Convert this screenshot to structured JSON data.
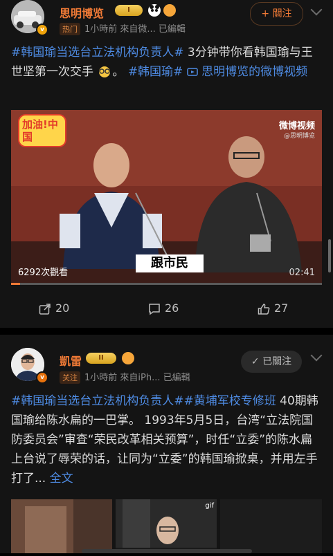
{
  "post1": {
    "author": "思明博览",
    "level": "I",
    "tag": "热门",
    "meta": "1小時前  來自微...  已編輯",
    "follow_label": "+ 關注",
    "text_hashtag1": "#韩国瑜当选台立法机构负责人#",
    "text_body": " 3分钟带你看韩国瑜与王世坚第一次交手",
    "text_end": "。",
    "text_hashtag2": "#韩国瑜#",
    "text_video_link": "思明博览的微博视频",
    "video": {
      "banner": "加油!中国",
      "watermark": "微博视频",
      "watermark_sub": "@思明博览",
      "view_count": "6292次觀看",
      "subtitle": "跟市民",
      "duration": "02:41",
      "progress": 0.03
    },
    "actions": {
      "share_count": "20",
      "comment_count": "26",
      "like_count": "27"
    }
  },
  "post2": {
    "author": "凱雷",
    "level": "II",
    "tag": "关注",
    "meta": "1小時前  來自iPh...  已編輯",
    "follow_label": "✓ 已關注",
    "text_hashtag1": "#韩国瑜当选台立法机构负责人#",
    "text_hashtag2": "#黄埔军校专修班",
    "text_body": "40期韩国瑜给陈水扁的一巴掌。    1993年5月5日，台湾“立法院国防委员会”审查“荣民改革相关预算”，时任“立委”的陈水扁上台说了辱荣的话，让同为“立委”的韩国瑜掀桌，并用左手打了...",
    "text_more": "全文",
    "gif_label": "gif"
  },
  "colors": {
    "accent": "#f07a36",
    "link": "#4e8be3",
    "background": "#000000",
    "card": "#141414"
  },
  "icons": [
    "share-icon",
    "comment-icon",
    "like-icon",
    "chevron-down-icon",
    "video-icon",
    "verified-icon"
  ]
}
